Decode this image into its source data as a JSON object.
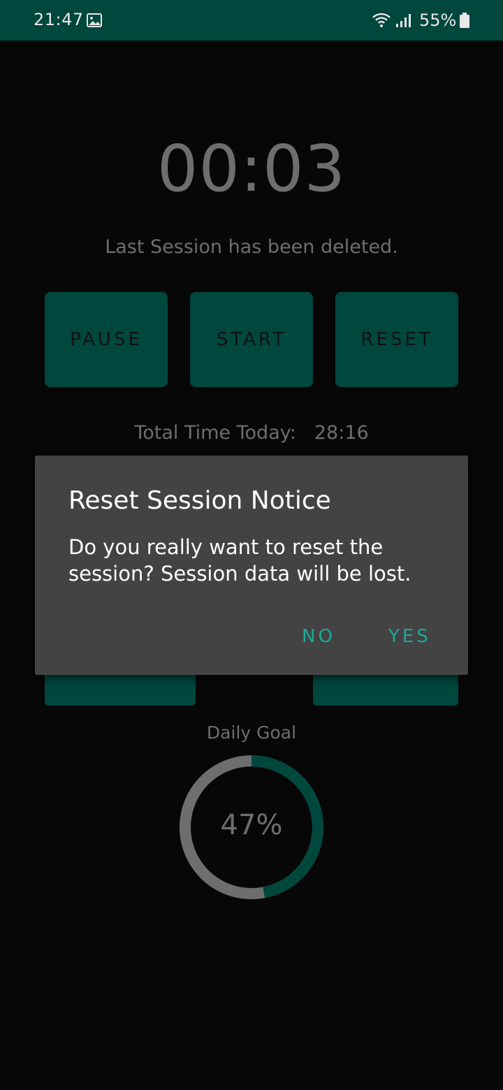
{
  "status_bar": {
    "time": "21:47",
    "battery": "55%",
    "icons": [
      "gallery-icon",
      "wifi-icon",
      "signal-icon",
      "battery-icon"
    ]
  },
  "timer": {
    "display": "00:03",
    "message": "Last Session has been deleted."
  },
  "controls": {
    "pause": "PAUSE",
    "start": "START",
    "reset": "RESET"
  },
  "total": {
    "label": "Total Time Today:",
    "value": "28:16"
  },
  "goal": {
    "label": "Daily Goal",
    "percent_text": "47%",
    "progress": 0.47
  },
  "dialog": {
    "title": "Reset Session Notice",
    "body": "Do you really want to reset the session? Session data will be lost.",
    "no": "NO",
    "yes": "YES"
  },
  "colors": {
    "accent": "#00473e",
    "dialog_bg": "#434343",
    "dialog_button": "#1aa99a",
    "muted_text": "#6e6e6e",
    "background": "#070707"
  }
}
